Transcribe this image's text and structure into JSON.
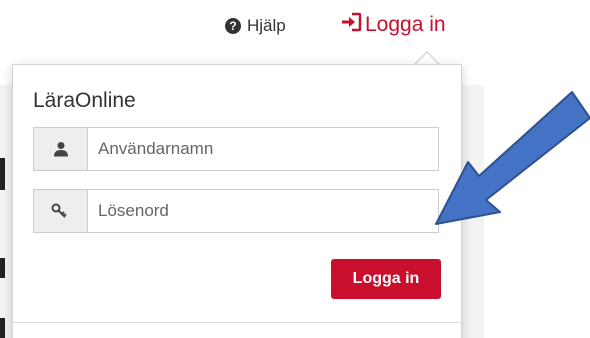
{
  "nav": {
    "help_label": "Hjälp",
    "help_icon": "?",
    "login_label": "Logga in"
  },
  "popover": {
    "title": "LäraOnline",
    "username_placeholder": "Användarnamn",
    "password_placeholder": "Lösenord",
    "submit_label": "Logga in"
  },
  "colors": {
    "brand": "#c8102e",
    "annotation_arrow": "#4472c4"
  },
  "icons": {
    "help": "question-circle-icon",
    "login": "sign-in-icon",
    "username": "user-icon",
    "password": "key-icon",
    "annotation": "arrow-icon"
  }
}
